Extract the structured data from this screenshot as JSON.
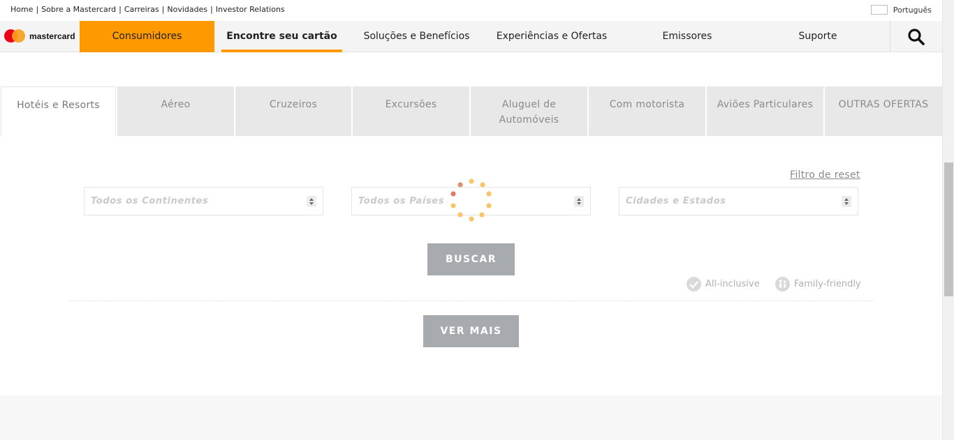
{
  "utility": {
    "links": [
      "Home",
      "Sobre a Mastercard",
      "Carreiras",
      "Novidades",
      "Investor Relations"
    ],
    "language": "Português"
  },
  "nav": {
    "logo_text": "mastercard",
    "items": [
      "Consumidores",
      "Encontre seu cartão",
      "Soluções e Benefícios",
      "Experiências e Ofertas",
      "Emissores",
      "Suporte"
    ],
    "active": "Consumidores",
    "underlined": "Encontre seu cartão",
    "search_icon": "search-icon"
  },
  "tabs": [
    {
      "label": "Hotéis e Resorts"
    },
    {
      "label": "Aéreo"
    },
    {
      "label": "Cruzeiros"
    },
    {
      "label": "Excursões"
    },
    {
      "label": "Aluguel de Automóveis"
    },
    {
      "label": "Com motorista"
    },
    {
      "label": "Aviões Particulares"
    },
    {
      "label": "OUTRAS OFERTAS"
    }
  ],
  "filters": {
    "reset_label": "Filtro de reset",
    "continent_placeholder": "Todos os Continentes",
    "country_placeholder": "Todos os Países",
    "city_placeholder": "Cidades e Estados"
  },
  "buttons": {
    "search": "BUSCAR",
    "more": "VER MAIS"
  },
  "badges": {
    "all_inclusive": "All-inclusive",
    "family_friendly": "Family-friendly"
  },
  "colors": {
    "accent": "#ff9900",
    "button": "#a7abb0",
    "mc_red": "#eb001b",
    "mc_yellow": "#f79e1b"
  }
}
